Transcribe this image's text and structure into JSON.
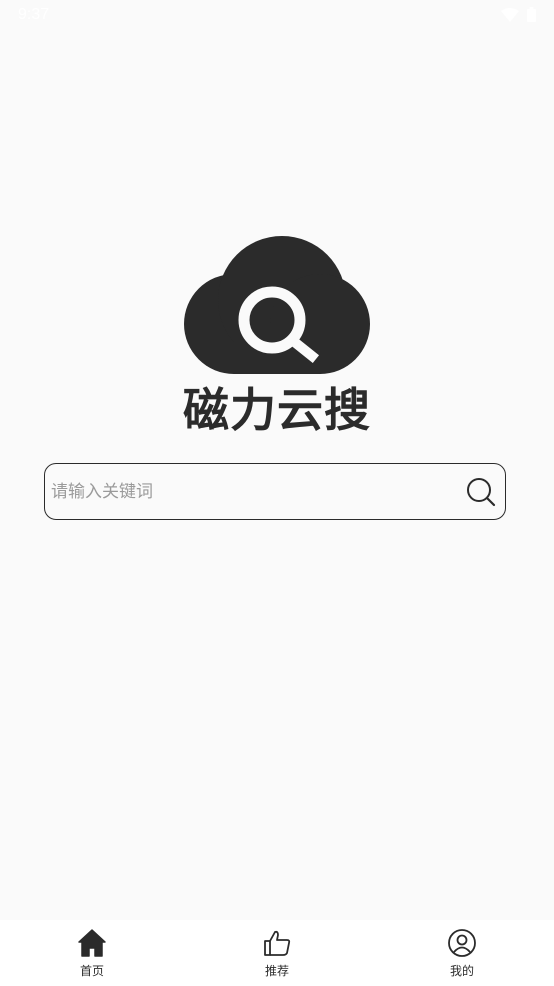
{
  "status_bar": {
    "time": "9:37",
    "icons": [
      "wifi-icon",
      "battery-icon"
    ]
  },
  "brand": {
    "name": "磁力云搜",
    "logo_icon": "cloud-search-icon",
    "color": "#2b2b2b"
  },
  "search": {
    "placeholder": "请输入关键词",
    "value": "",
    "button_icon": "search-icon"
  },
  "tab_bar": {
    "tabs": [
      {
        "label": "首页",
        "icon": "home-icon",
        "active": true
      },
      {
        "label": "推荐",
        "icon": "thumbs-up-icon",
        "active": false
      },
      {
        "label": "我的",
        "icon": "user-icon",
        "active": false
      }
    ]
  }
}
